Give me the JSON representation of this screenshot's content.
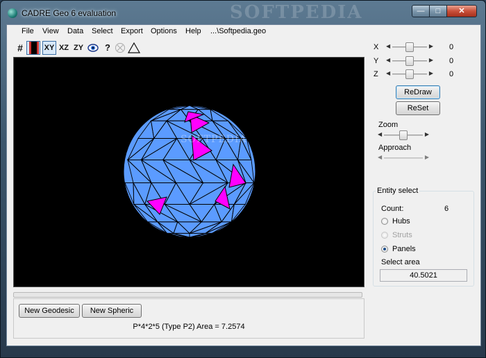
{
  "window": {
    "title": "CADRE Geo 6 evaluation",
    "watermark": "SOFTPEDIA",
    "controls": {
      "minimize": "—",
      "maximize": "□",
      "close": "✕"
    }
  },
  "menu": [
    "File",
    "View",
    "Data",
    "Select",
    "Export",
    "Options",
    "Help"
  ],
  "menu_path": "...\\Softpedia.geo",
  "toolbar": {
    "grid_icon": "#",
    "film_icon": "film-icon",
    "xy": "XY",
    "xz": "XZ",
    "zy": "ZY",
    "eye_icon": "eye-icon",
    "help": "?",
    "circle_icon": "circle-x-icon",
    "triangle_icon": "triangle-icon"
  },
  "viewport": {
    "watermark": "SOFTPEDIA",
    "sphere_color": "#5b9bff",
    "highlight_color": "#ff00ff",
    "background": "#000000"
  },
  "bottom": {
    "new_geodesic": "New Geodesic",
    "new_spheric": "New Spheric",
    "status": "P*4*2*5 (Type P2)  Area = 7.2574"
  },
  "rotation": {
    "x": {
      "label": "X",
      "value": "0",
      "level": 0.5
    },
    "y": {
      "label": "Y",
      "value": "0",
      "level": 0.5
    },
    "z": {
      "label": "Z",
      "value": "0",
      "level": 0.5
    }
  },
  "buttons": {
    "redraw": "ReDraw",
    "reset": "ReSet"
  },
  "zoom": {
    "label": "Zoom",
    "level": 0.5
  },
  "approach": {
    "label": "Approach",
    "level": 0.0
  },
  "entity_select": {
    "title": "Entity select",
    "count_label": "Count:",
    "count_value": "6",
    "options": [
      {
        "label": "Hubs",
        "checked": false,
        "disabled": false
      },
      {
        "label": "Struts",
        "checked": false,
        "disabled": true
      },
      {
        "label": "Panels",
        "checked": true,
        "disabled": false
      }
    ],
    "area_label": "Select area",
    "area_value": "40.5021"
  }
}
